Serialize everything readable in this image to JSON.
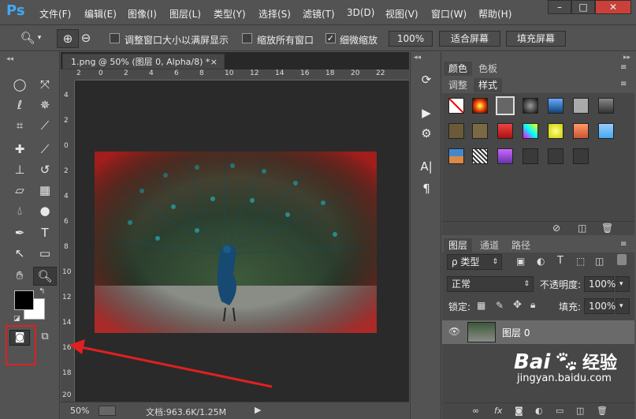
{
  "app": {
    "logo": "Ps"
  },
  "menu": [
    "文件(F)",
    "编辑(E)",
    "图像(I)",
    "图层(L)",
    "类型(Y)",
    "选择(S)",
    "滤镜(T)",
    "3D(D)",
    "视图(V)",
    "窗口(W)",
    "帮助(H)"
  ],
  "window_controls": {
    "minimize": "–",
    "maximize": "□",
    "close": "✕"
  },
  "options": {
    "resize_windows_label": "调整窗口大小以满屏显示",
    "zoom_all_label": "缩放所有窗口",
    "scrubby_zoom_label": "细微缩放",
    "zoom_value": "100%",
    "fit_screen_label": "适合屏幕",
    "fill_screen_label": "填充屏幕",
    "resize_windows_checked": false,
    "zoom_all_checked": false,
    "scrubby_zoom_checked": true
  },
  "document": {
    "tab_title": "1.png @ 50% (图层 0, Alpha/8) *",
    "close_glyph": "×",
    "ruler_h": [
      "2",
      "0",
      "2",
      "4",
      "6",
      "8",
      "10",
      "12",
      "14",
      "16",
      "18",
      "20",
      "22"
    ],
    "ruler_v": [
      "4",
      "2",
      "0",
      "2",
      "4",
      "6",
      "8",
      "10",
      "12",
      "14",
      "16",
      "18",
      "20"
    ],
    "zoom": "50%",
    "doc_info": "文档:963.6K/1.25M"
  },
  "panels": {
    "color_tabs": [
      "颜色",
      "色板"
    ],
    "style_tabs": [
      "调整",
      "样式"
    ],
    "layer_tabs": [
      "图层",
      "通道",
      "路径"
    ],
    "filter_kind": "ρ 类型",
    "blend_mode": "正常",
    "opacity_label": "不透明度:",
    "opacity_value": "100%",
    "lock_label": "锁定:",
    "fill_label": "填充:",
    "fill_value": "100%",
    "layer_name": "图层 0"
  },
  "watermark": {
    "brand_prefix": "Bai",
    "brand_suffix": "经验",
    "url": "jingyan.baidu.com"
  },
  "colors": {
    "accent_red": "#e02020",
    "ps_blue": "#3fa9f5",
    "doc_bg": "#282828"
  }
}
